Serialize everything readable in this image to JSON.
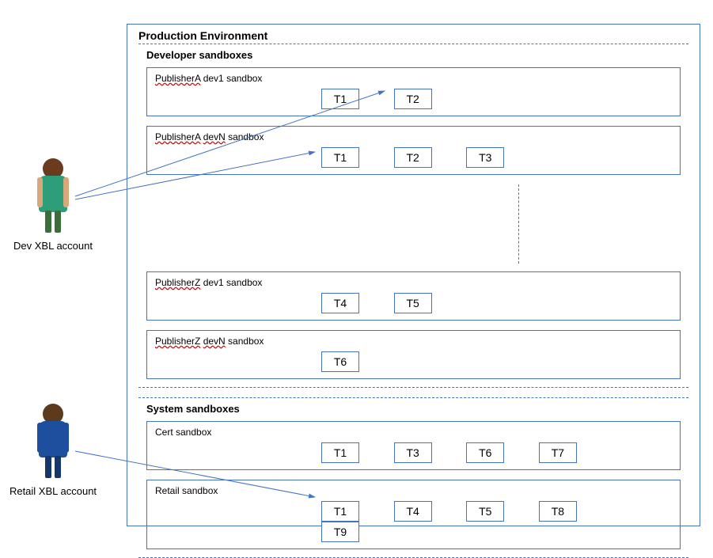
{
  "main_title": "Production Environment",
  "dev_section_title": "Developer sandboxes",
  "sys_section_title": "System sandboxes",
  "sandboxes": {
    "pubA_dev1": {
      "label_prefix": "PublisherA",
      "label_rest": " dev1 sandbox",
      "boxes": [
        "T1",
        "T2"
      ]
    },
    "pubA_devN": {
      "label_prefix": "PublisherA",
      "label_suffix": "devN",
      "label_rest": " sandbox",
      "boxes": [
        "T1",
        "T2",
        "T3"
      ]
    },
    "pubZ_dev1": {
      "label_prefix": "PublisherZ",
      "label_rest": " dev1 sandbox",
      "boxes": [
        "T4",
        "T5"
      ]
    },
    "pubZ_devN": {
      "label_prefix": "PublisherZ",
      "label_suffix": "devN",
      "label_rest": " sandbox",
      "boxes": [
        "T6"
      ]
    },
    "cert": {
      "label_plain": "Cert sandbox",
      "boxes": [
        "T1",
        "T3",
        "T6",
        "T7"
      ]
    },
    "retail": {
      "label_plain": "Retail sandbox",
      "boxes": [
        "T1",
        "T4",
        "T5",
        "T8",
        "T9"
      ]
    }
  },
  "avatars": {
    "dev": {
      "label": "Dev XBL account"
    },
    "retail": {
      "label": "Retail XBL account"
    }
  }
}
